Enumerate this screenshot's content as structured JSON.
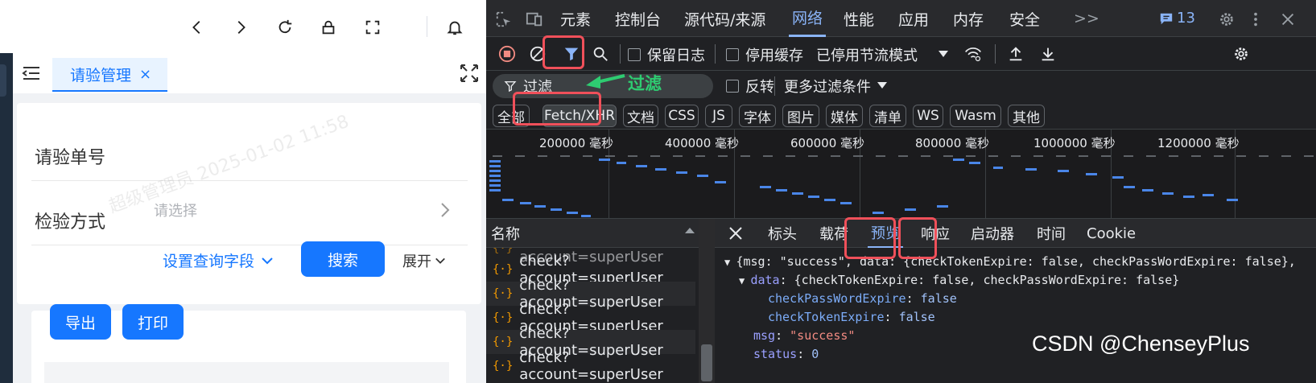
{
  "app": {
    "tab": {
      "label": "请验管理",
      "close": "×"
    },
    "watermark": "超级管理员 2025-01-02 11:58",
    "form": {
      "field1_label": "请验单号",
      "field2_label": "检验方式",
      "field2_placeholder": "请选择",
      "set_fields_label": "设置查询字段",
      "search_button": "搜索",
      "expand_label": "展开"
    },
    "actions": {
      "export": "导出",
      "print": "打印"
    }
  },
  "devtools": {
    "panels": [
      "元素",
      "控制台",
      "源代码/来源",
      "网络",
      "性能",
      "应用",
      "内存",
      "安全"
    ],
    "active_panel": "网络",
    "issues_count": "13",
    "more_tabs": ">>",
    "toolbar": {
      "preserve_log": "保留日志",
      "disable_cache": "停用缓存",
      "throttle": "已停用节流模式"
    },
    "filter": {
      "placeholder": "过滤",
      "callout": "过滤",
      "invert": "反转",
      "more_filters": "更多过滤条件"
    },
    "types": [
      "全部",
      "Fetch/XHR",
      "文档",
      "CSS",
      "JS",
      "字体",
      "图片",
      "媒体",
      "清单",
      "WS",
      "Wasm",
      "其他"
    ],
    "active_type": "Fetch/XHR",
    "timeline_ticks": [
      "200000 毫秒",
      "400000 毫秒",
      "600000 毫秒",
      "800000 毫秒",
      "1000000 毫秒",
      "1200000 毫秒"
    ],
    "request_list": {
      "header": "名称",
      "items": [
        "check?account=superUser",
        "check?account=superUser",
        "check?account=superUser",
        "check?account=superUser",
        "check?account=superUser",
        "check?account=superUser",
        "check?account=superUser"
      ]
    },
    "detail_tabs": [
      "标头",
      "载荷",
      "预览",
      "响应",
      "启动器",
      "时间",
      "Cookie"
    ],
    "active_detail_tab": "预览",
    "preview": {
      "line1": "{msg: \"success\", data: {checkTokenExpire: false, checkPassWordExpire: false},",
      "data_key": "data",
      "data_value": "{checkTokenExpire: false, checkPassWordExpire: false}",
      "k1": "checkPassWordExpire",
      "v1": "false",
      "k2": "checkTokenExpire",
      "v2": "false",
      "k3": "msg",
      "v3": "\"success\"",
      "k4": "status",
      "v4": "0"
    }
  },
  "watermark_credit": "CSDN @ChenseyPlus",
  "colors": {
    "accent": "#1677ff",
    "devtools_accent": "#8ab4f8",
    "highlight": "#f0505a",
    "callout": "#2ecc71"
  }
}
